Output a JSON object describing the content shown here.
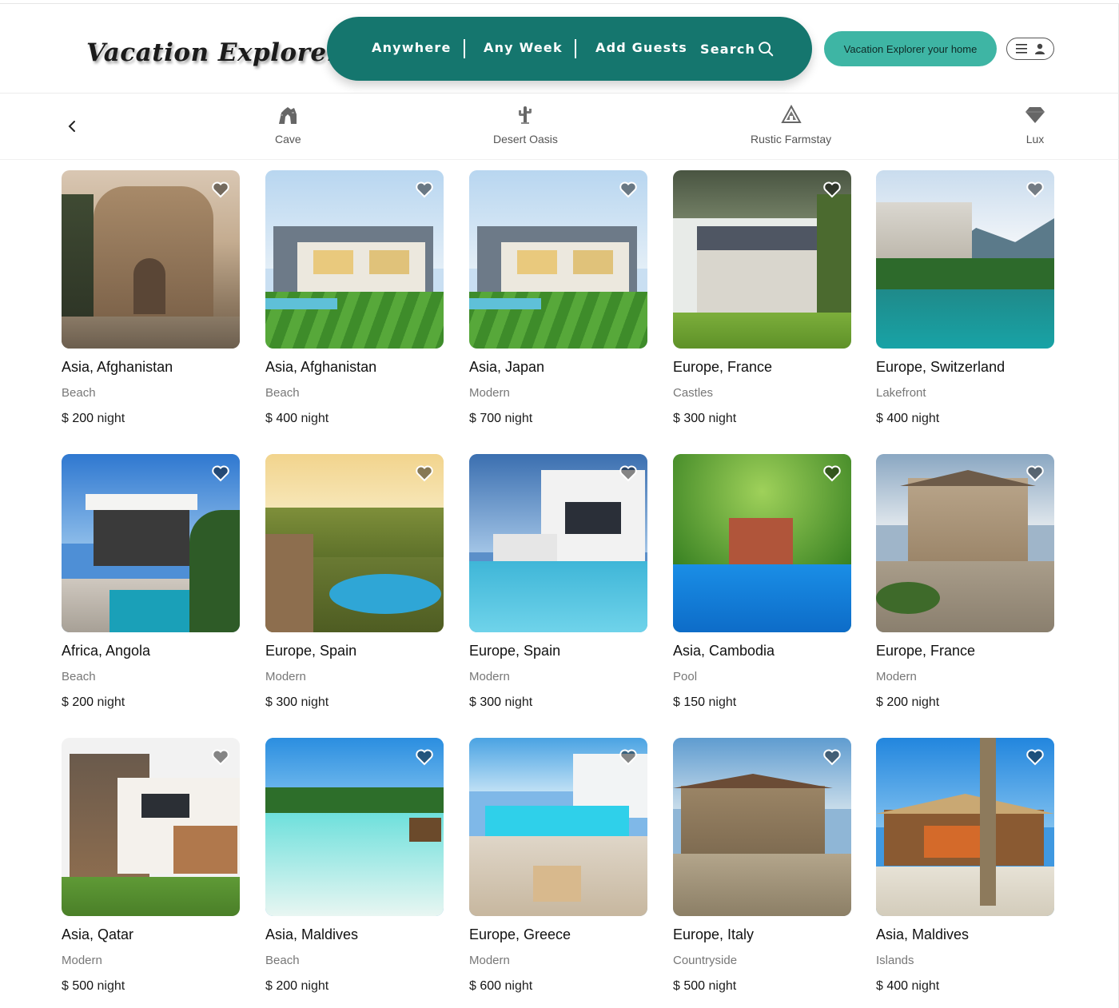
{
  "brand": {
    "logo_text": "Vacation Explorer"
  },
  "search": {
    "anywhere": "Anywhere",
    "week": "Any Week",
    "guests": "Add Guests",
    "search": "Search"
  },
  "header": {
    "host_button": "Vacation Explorer your home"
  },
  "categories": [
    {
      "label": "Cave",
      "icon": "cave-icon"
    },
    {
      "label": "Desert Oasis",
      "icon": "cactus-icon"
    },
    {
      "label": "Rustic Farmstay",
      "icon": "farmstay-icon"
    },
    {
      "label": "Lux",
      "icon": "diamond-icon"
    }
  ],
  "currency": "$",
  "price_suffix": "night",
  "listings": [
    {
      "location": "Asia, Afghanistan",
      "category": "Beach",
      "price": "200"
    },
    {
      "location": "Asia, Afghanistan",
      "category": "Beach",
      "price": "400"
    },
    {
      "location": "Asia, Japan",
      "category": "Modern",
      "price": "700"
    },
    {
      "location": "Europe, France",
      "category": "Castles",
      "price": "300"
    },
    {
      "location": "Europe, Switzerland",
      "category": "Lakefront",
      "price": "400"
    },
    {
      "location": "Africa, Angola",
      "category": "Beach",
      "price": "200"
    },
    {
      "location": "Europe, Spain",
      "category": "Modern",
      "price": "300"
    },
    {
      "location": "Europe, Spain",
      "category": "Modern",
      "price": "300"
    },
    {
      "location": "Asia, Cambodia",
      "category": "Pool",
      "price": "150"
    },
    {
      "location": "Europe, France",
      "category": "Modern",
      "price": "200"
    },
    {
      "location": "Asia, Qatar",
      "category": "Modern",
      "price": "500"
    },
    {
      "location": "Asia, Maldives",
      "category": "Beach",
      "price": "200"
    },
    {
      "location": "Europe, Greece",
      "category": "Modern",
      "price": "600"
    },
    {
      "location": "Europe, Italy",
      "category": "Countryside",
      "price": "500"
    },
    {
      "location": "Asia, Maldives",
      "category": "Islands",
      "price": "400"
    }
  ],
  "colors": {
    "brand": "#15766e",
    "accent": "#3eb5a4"
  }
}
